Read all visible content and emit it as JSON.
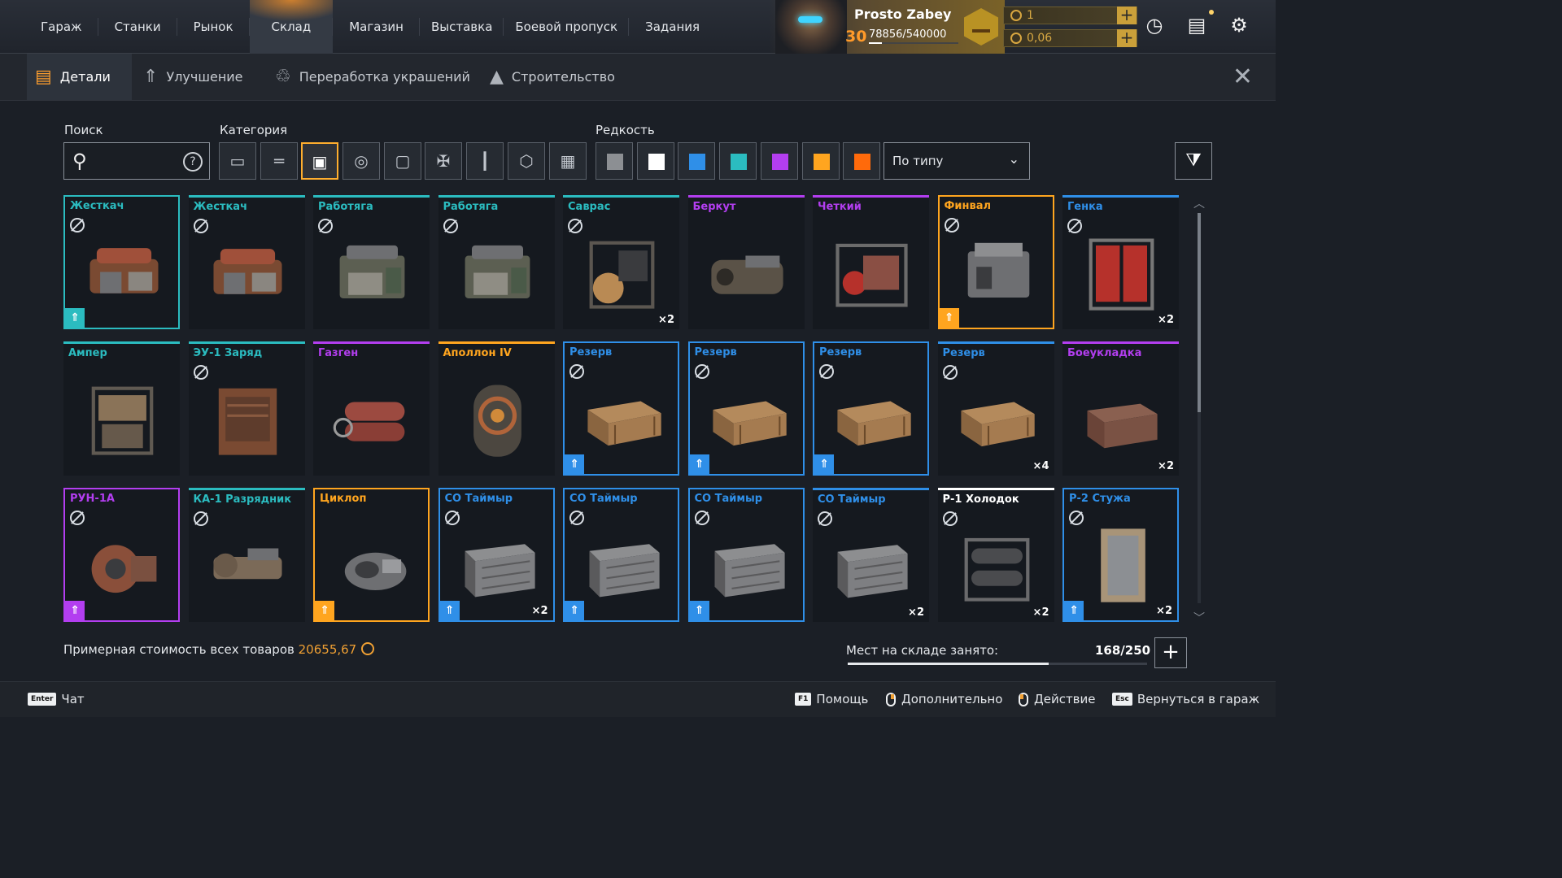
{
  "nav": {
    "items": [
      "Гараж",
      "Станки",
      "Рынок",
      "Склад",
      "Магазин",
      "Выставка",
      "Боевой пропуск",
      "Задания"
    ],
    "active": "Склад"
  },
  "player": {
    "name": "Prosto Zabey",
    "level": "30",
    "xp": "78856/540000",
    "xp_progress": 0.146
  },
  "currency": [
    {
      "value": "1",
      "icon": "coin-icon"
    },
    {
      "value": "0,06",
      "icon": "coupon-icon"
    }
  ],
  "top_icons": [
    "speedometer-icon",
    "chat-icon",
    "gear-icon"
  ],
  "subtabs": {
    "details": "Детали",
    "upgrade": "Улучшение",
    "recycle": "Переработка украшений",
    "build": "Строительство"
  },
  "filters": {
    "search_label": "Поиск",
    "search_placeholder": "",
    "category_label": "Категория",
    "rarity_label": "Редкость",
    "sort_value": "По типу",
    "categories": [
      "cabin-icon",
      "weapon-icon",
      "engine-icon",
      "wheel-icon",
      "frame-icon",
      "armor-icon",
      "paint-icon",
      "module-icon",
      "grid-icon"
    ],
    "active_category": 2,
    "rarity_colors": [
      "#8c8f93",
      "#ffffff",
      "#2f8fe8",
      "#2bbcc0",
      "#b33ef0",
      "#ffa51f",
      "#ff6a0b"
    ]
  },
  "rarity": {
    "common": "#8c8f93",
    "rare": "#2f8fe8",
    "special": "#2bbcc0",
    "epic": "#b33ef0",
    "legendary": "#ffa51f",
    "white": "#ffffff"
  },
  "items": [
    {
      "name": "Жесткач",
      "rarity": "special",
      "selected": true,
      "nocraft": true,
      "upgrade": true,
      "count": "",
      "kind": "engine-red"
    },
    {
      "name": "Жесткач",
      "rarity": "special",
      "selected": false,
      "nocraft": true,
      "upgrade": false,
      "count": "",
      "kind": "engine-red"
    },
    {
      "name": "Работяга",
      "rarity": "special",
      "selected": false,
      "nocraft": true,
      "upgrade": false,
      "count": "",
      "kind": "engine-green"
    },
    {
      "name": "Работяга",
      "rarity": "special",
      "selected": false,
      "nocraft": true,
      "upgrade": false,
      "count": "",
      "kind": "engine-green"
    },
    {
      "name": "Саврас",
      "rarity": "special",
      "selected": false,
      "nocraft": true,
      "upgrade": false,
      "count": "×2",
      "kind": "engine-frame"
    },
    {
      "name": "Беркут",
      "rarity": "epic",
      "selected": false,
      "nocraft": false,
      "upgrade": false,
      "count": "",
      "kind": "engine-dark"
    },
    {
      "name": "Четкий",
      "rarity": "epic",
      "selected": false,
      "nocraft": false,
      "upgrade": false,
      "count": "",
      "kind": "engine-redframe"
    },
    {
      "name": "Финвал",
      "rarity": "legendary",
      "selected": true,
      "nocraft": true,
      "upgrade": true,
      "count": "",
      "kind": "engine-grey"
    },
    {
      "name": "Генка",
      "rarity": "rare",
      "selected": false,
      "nocraft": true,
      "upgrade": false,
      "count": "×2",
      "kind": "cans-red"
    },
    {
      "name": "Ампер",
      "rarity": "special",
      "selected": false,
      "nocraft": false,
      "upgrade": false,
      "count": "",
      "kind": "generator"
    },
    {
      "name": "ЭУ-1 Заряд",
      "rarity": "special",
      "selected": false,
      "nocraft": true,
      "upgrade": false,
      "count": "",
      "kind": "generator-box"
    },
    {
      "name": "Газген",
      "rarity": "epic",
      "selected": false,
      "nocraft": false,
      "upgrade": false,
      "count": "",
      "kind": "gas-tanks"
    },
    {
      "name": "Аполлон IV",
      "rarity": "legendary",
      "selected": false,
      "nocraft": false,
      "upgrade": false,
      "count": "",
      "kind": "reactor"
    },
    {
      "name": "Резерв",
      "rarity": "rare",
      "selected": true,
      "nocraft": true,
      "upgrade": true,
      "count": "",
      "kind": "crate"
    },
    {
      "name": "Резерв",
      "rarity": "rare",
      "selected": true,
      "nocraft": true,
      "upgrade": true,
      "count": "",
      "kind": "crate"
    },
    {
      "name": "Резерв",
      "rarity": "rare",
      "selected": true,
      "nocraft": true,
      "upgrade": true,
      "count": "",
      "kind": "crate"
    },
    {
      "name": "Резерв",
      "rarity": "rare",
      "selected": false,
      "nocraft": true,
      "upgrade": false,
      "count": "×4",
      "kind": "crate"
    },
    {
      "name": "Боеукладка",
      "rarity": "epic",
      "selected": false,
      "nocraft": false,
      "upgrade": false,
      "count": "×2",
      "kind": "ammo-box"
    },
    {
      "name": "РУН-1А",
      "rarity": "epic",
      "selected": true,
      "nocraft": true,
      "upgrade": true,
      "count": "",
      "kind": "rusty-motor"
    },
    {
      "name": "КА-1 Разрядник",
      "rarity": "special",
      "selected": false,
      "nocraft": true,
      "upgrade": false,
      "count": "",
      "kind": "discharger"
    },
    {
      "name": "Циклоп",
      "rarity": "legendary",
      "selected": true,
      "nocraft": false,
      "upgrade": true,
      "count": "",
      "kind": "cyclops"
    },
    {
      "name": "СО Таймыр",
      "rarity": "rare",
      "selected": true,
      "nocraft": true,
      "upgrade": true,
      "count": "×2",
      "kind": "radiator"
    },
    {
      "name": "СО Таймыр",
      "rarity": "rare",
      "selected": true,
      "nocraft": true,
      "upgrade": true,
      "count": "",
      "kind": "radiator"
    },
    {
      "name": "СО Таймыр",
      "rarity": "rare",
      "selected": true,
      "nocraft": true,
      "upgrade": true,
      "count": "",
      "kind": "radiator"
    },
    {
      "name": "СО Таймыр",
      "rarity": "rare",
      "selected": false,
      "nocraft": true,
      "upgrade": false,
      "count": "×2",
      "kind": "radiator"
    },
    {
      "name": "Р-1 Холодок",
      "rarity": "white",
      "selected": false,
      "nocraft": true,
      "upgrade": false,
      "count": "×2",
      "kind": "cooler"
    },
    {
      "name": "Р-2 Стужа",
      "rarity": "rare",
      "selected": true,
      "nocraft": true,
      "upgrade": true,
      "count": "×2",
      "kind": "cooler-tall"
    }
  ],
  "footer": {
    "value_label": "Примерная стоимость всех товаров",
    "value_amount": "20655,67",
    "storage_label": "Мест на складе занято:",
    "storage_value": "168/250",
    "storage_fraction": 0.672
  },
  "hints": [
    {
      "key": "Enter",
      "label": "Чат"
    },
    {
      "key": "F1",
      "label": "Помощь"
    },
    {
      "key": "mouse-right",
      "label": "Дополнительно"
    },
    {
      "key": "mouse-left",
      "label": "Действие"
    },
    {
      "key": "Esc",
      "label": "Вернуться в гараж"
    }
  ]
}
